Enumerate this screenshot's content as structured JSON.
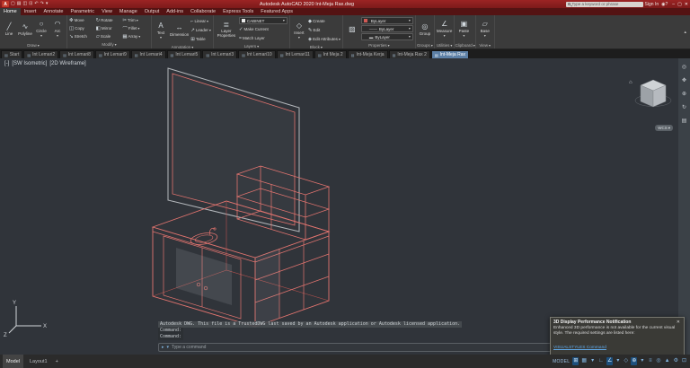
{
  "ui": {
    "caret_down": "▾",
    "caret_up": "▴",
    "file_icon": "▤"
  },
  "colors": {
    "titlebar_red": "#8e1f1f",
    "ribbon_gray": "#3b3b3b",
    "canvas_gray": "#30343a",
    "wire_red": "#e2746f",
    "wire_gray": "#b4b8bc",
    "accent_blue": "#7fb2dd",
    "active_file_tab": "#5d80a6"
  },
  "titlebar": {
    "app_initial": "A",
    "qat": [
      {
        "name": "new-file-icon",
        "glyph": "▢"
      },
      {
        "name": "open-file-icon",
        "glyph": "▤"
      },
      {
        "name": "save-icon",
        "glyph": "◫"
      },
      {
        "name": "plot-icon",
        "glyph": "⊡"
      },
      {
        "name": "undo-icon",
        "glyph": "↶"
      },
      {
        "name": "redo-icon",
        "glyph": "↷"
      },
      {
        "name": "qat-menu-icon",
        "glyph": "▾"
      }
    ],
    "title": "Autodesk AutoCAD 2020   Int-Meja Rax.dwg",
    "search_placeholder": "Type a keyword or phrase",
    "signin_label": "Sign In",
    "right_icons": [
      {
        "name": "account-icon",
        "glyph": "◉"
      },
      {
        "name": "help-icon",
        "glyph": "?"
      }
    ],
    "window_buttons": [
      {
        "name": "minimize-button",
        "glyph": "–"
      },
      {
        "name": "maximize-button",
        "glyph": "▢"
      },
      {
        "name": "close-button",
        "glyph": "✕"
      }
    ]
  },
  "ribbon_tabs": [
    {
      "label": "Home",
      "active": true
    },
    {
      "label": "Insert"
    },
    {
      "label": "Annotate"
    },
    {
      "label": "Parametric"
    },
    {
      "label": "View"
    },
    {
      "label": "Manage"
    },
    {
      "label": "Output"
    },
    {
      "label": "Add-ins"
    },
    {
      "label": "Collaborate"
    },
    {
      "label": "Express Tools"
    },
    {
      "label": "Featured Apps"
    }
  ],
  "ribbon": {
    "draw": {
      "label": "Draw",
      "buttons": [
        {
          "name": "line-button",
          "glyph": "╱",
          "label": "Line"
        },
        {
          "name": "polyline-button",
          "glyph": "∿",
          "label": "Polyline"
        },
        {
          "name": "circle-button",
          "glyph": "○",
          "label": "Circle",
          "menu": true
        },
        {
          "name": "arc-button",
          "glyph": "◠",
          "label": "Arc",
          "menu": true
        }
      ]
    },
    "modify": {
      "label": "Modify",
      "buttons": [
        {
          "name": "move-button",
          "glyph": "✥",
          "label": "Move"
        },
        {
          "name": "rotate-button",
          "glyph": "↻",
          "label": "Rotate"
        },
        {
          "name": "trim-button",
          "glyph": "✂",
          "label": "Trim",
          "menu": true
        },
        {
          "name": "copy-button",
          "glyph": "◫",
          "label": "Copy"
        },
        {
          "name": "mirror-button",
          "glyph": "◧",
          "label": "Mirror"
        },
        {
          "name": "fillet-button",
          "glyph": "⌒",
          "label": "Fillet",
          "menu": true
        },
        {
          "name": "stretch-button",
          "glyph": "↘",
          "label": "Stretch"
        },
        {
          "name": "scale-button",
          "glyph": "▱",
          "label": "Scale"
        },
        {
          "name": "array-button",
          "glyph": "▦",
          "label": "Array",
          "menu": true
        }
      ]
    },
    "annotation": {
      "label": "Annotation",
      "big": [
        {
          "name": "text-button",
          "glyph": "A",
          "label": "Text",
          "menu": true
        },
        {
          "name": "dimension-button",
          "glyph": "↔",
          "label": "Dimension"
        }
      ],
      "small": [
        {
          "name": "linear-button",
          "glyph": "⌐",
          "label": "Linear",
          "menu": true
        },
        {
          "name": "leader-button",
          "glyph": "↗",
          "label": "Leader",
          "menu": true
        },
        {
          "name": "table-button",
          "glyph": "⊞",
          "label": "Table"
        }
      ]
    },
    "layers": {
      "label": "Layers",
      "big": {
        "name": "layer-properties-button",
        "glyph": "≣",
        "label": "Layer Properties"
      },
      "combo_value": "CABINET",
      "combo_swatch": "#e9e9e9",
      "small": [
        {
          "name": "make-current-button",
          "glyph": "✓",
          "label": "Make Current"
        },
        {
          "name": "match-layer-button",
          "glyph": "≈",
          "label": "Match Layer"
        }
      ]
    },
    "block": {
      "label": "Block",
      "big": {
        "name": "insert-button",
        "glyph": "◇",
        "label": "Insert",
        "menu": true
      },
      "small": [
        {
          "name": "create-block-button",
          "glyph": "◆",
          "label": "Create"
        },
        {
          "name": "edit-block-button",
          "glyph": "✎",
          "label": "Edit"
        },
        {
          "name": "edit-attributes-button",
          "glyph": "◈",
          "label": "Edit Attributes",
          "menu": true
        }
      ]
    },
    "properties": {
      "label": "Properties",
      "match_icon": {
        "name": "match-properties-button",
        "glyph": "▨"
      },
      "rows": [
        {
          "name": "object-color-select",
          "swatch": "#cf5a55",
          "value": "ByLayer"
        },
        {
          "name": "linetype-select",
          "lead": "——",
          "value": "ByLayer"
        },
        {
          "name": "lineweight-select",
          "lead": "▬",
          "value": "ByLayer"
        }
      ]
    },
    "single_panels": [
      {
        "label": "Groups",
        "menu": true,
        "big": {
          "name": "group-button",
          "glyph": "◎",
          "label": "Group"
        }
      },
      {
        "label": "Utilities",
        "menu": true,
        "big": {
          "name": "measure-button",
          "glyph": "∠",
          "label": "Measure",
          "menu": true
        }
      },
      {
        "label": "Clipboard",
        "big": {
          "name": "paste-button",
          "glyph": "▣",
          "label": "Paste",
          "menu": true
        }
      },
      {
        "label": "View",
        "big": {
          "name": "base-view-button",
          "glyph": "▱",
          "label": "Base",
          "menu": true
        }
      }
    ]
  },
  "file_tabs": [
    {
      "label": "Start"
    },
    {
      "label": "Int Lemari2"
    },
    {
      "label": "Int Lemari8"
    },
    {
      "label": "Int Lemari9"
    },
    {
      "label": "Int Lemari4"
    },
    {
      "label": "Int Lemari5"
    },
    {
      "label": "Int Lemari3"
    },
    {
      "label": "Int Lemari10"
    },
    {
      "label": "Int Lemari11"
    },
    {
      "label": "Int Meja 2"
    },
    {
      "label": "Int-Meja Kerja"
    },
    {
      "label": "Int-Meja Rax 2"
    },
    {
      "label": "Int-Meja Rax",
      "active": true
    }
  ],
  "viewport": {
    "controls": [
      "[-]",
      "[SW Isometric]",
      "[2D Wireframe]"
    ],
    "home_icon": "⌂",
    "wcs_label": "WCS",
    "ucs": {
      "x_label": "X",
      "y_label": "Y",
      "z_label": "Z"
    },
    "navbar_icons": [
      {
        "name": "navigation-wheel-icon",
        "glyph": "◎"
      },
      {
        "name": "pan-icon",
        "glyph": "✥"
      },
      {
        "name": "zoom-icon",
        "glyph": "⊕"
      },
      {
        "name": "orbit-icon",
        "glyph": "↻"
      },
      {
        "name": "showmotion-icon",
        "glyph": "▤"
      }
    ]
  },
  "command": {
    "trusted_message": "Autodesk DWG.  This file is a TrustedDWG last saved by an Autodesk application or Autodesk licensed application.",
    "history": [
      "Command:",
      "Command:"
    ],
    "prompt_icon": "▸",
    "menu_icon": "▾",
    "placeholder": "Type a command"
  },
  "notification": {
    "title": "3D Display Performance Notification",
    "close_icon": "✕",
    "body": "Enhanced 3D performance is not available for the current visual style. The required settings are listed here:",
    "link": "VISUALSTYLES Command"
  },
  "statusbar": {
    "model_tab": "Model",
    "layout_tab": "Layout1",
    "new_layout": "+",
    "space_label": "MODEL",
    "icons": [
      {
        "name": "grid-icon",
        "glyph": "⊞",
        "active": true
      },
      {
        "name": "snap-icon",
        "glyph": "▦"
      },
      {
        "name": "snap-menu-icon",
        "glyph": "▾"
      },
      {
        "name": "ortho-icon",
        "glyph": "∟"
      },
      {
        "name": "polar-tracking-icon",
        "glyph": "∠",
        "active": true
      },
      {
        "name": "polar-menu-icon",
        "glyph": "▾"
      },
      {
        "name": "isodraft-icon",
        "glyph": "◇"
      },
      {
        "name": "osnap-icon",
        "glyph": "⊕",
        "active": true
      },
      {
        "name": "osnap-menu-icon",
        "glyph": "▾"
      },
      {
        "name": "lineweight-icon",
        "glyph": "≡"
      },
      {
        "name": "selection-cycling-icon",
        "glyph": "◎"
      },
      {
        "name": "annotation-scale-icon",
        "glyph": "▲"
      },
      {
        "name": "workspace-gear-icon",
        "glyph": "⚙"
      },
      {
        "name": "clean-screen-icon",
        "glyph": "⊡"
      }
    ]
  }
}
